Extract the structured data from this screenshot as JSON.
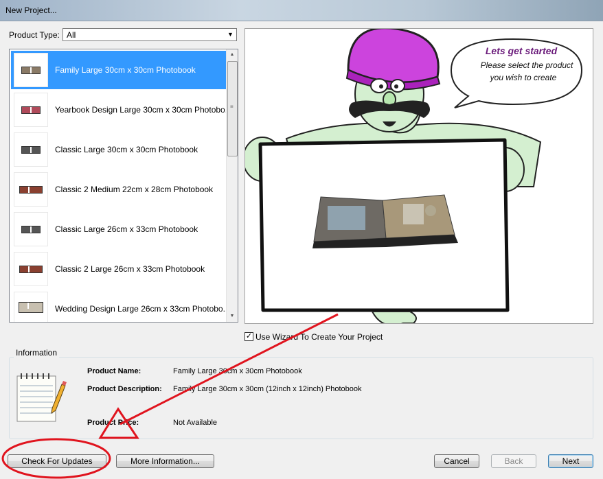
{
  "window": {
    "title": "New Project..."
  },
  "product_type": {
    "label": "Product Type:",
    "value": "All"
  },
  "products": [
    {
      "label": "Family Large 30cm x 30cm Photobook",
      "selected": true
    },
    {
      "label": "Yearbook Design Large 30cm x 30cm Photobo...",
      "selected": false
    },
    {
      "label": "Classic Large 30cm x 30cm Photobook",
      "selected": false
    },
    {
      "label": "Classic 2 Medium 22cm x 28cm Photobook",
      "selected": false
    },
    {
      "label": "Classic Large 26cm x 33cm Photobook",
      "selected": false
    },
    {
      "label": "Classic 2 Large 26cm x 33cm Photobook",
      "selected": false
    },
    {
      "label": "Wedding Design Large 26cm x 33cm Photobo...",
      "selected": false
    }
  ],
  "speech": {
    "heading": "Lets get started",
    "line1": "Please select the product",
    "line2": "you wish to create"
  },
  "wizard": {
    "label": "Use Wizard To Create Your Project",
    "checked": true
  },
  "information": {
    "title": "Information",
    "name_label": "Product Name:",
    "name_value": "Family Large 30cm x 30cm Photobook",
    "desc_label": "Product Description:",
    "desc_value": "Family Large 30cm x 30cm (12inch x 12inch) Photobook",
    "price_label": "Product Price:",
    "price_value": "Not Available"
  },
  "buttons": {
    "check_updates": "Check For Updates",
    "more_info": "More Information...",
    "cancel": "Cancel",
    "back": "Back",
    "next": "Next"
  },
  "colors": {
    "selection": "#3399ff",
    "annotation": "#e0141e",
    "turban": "#cc44dd",
    "skin": "#d4efd0"
  }
}
